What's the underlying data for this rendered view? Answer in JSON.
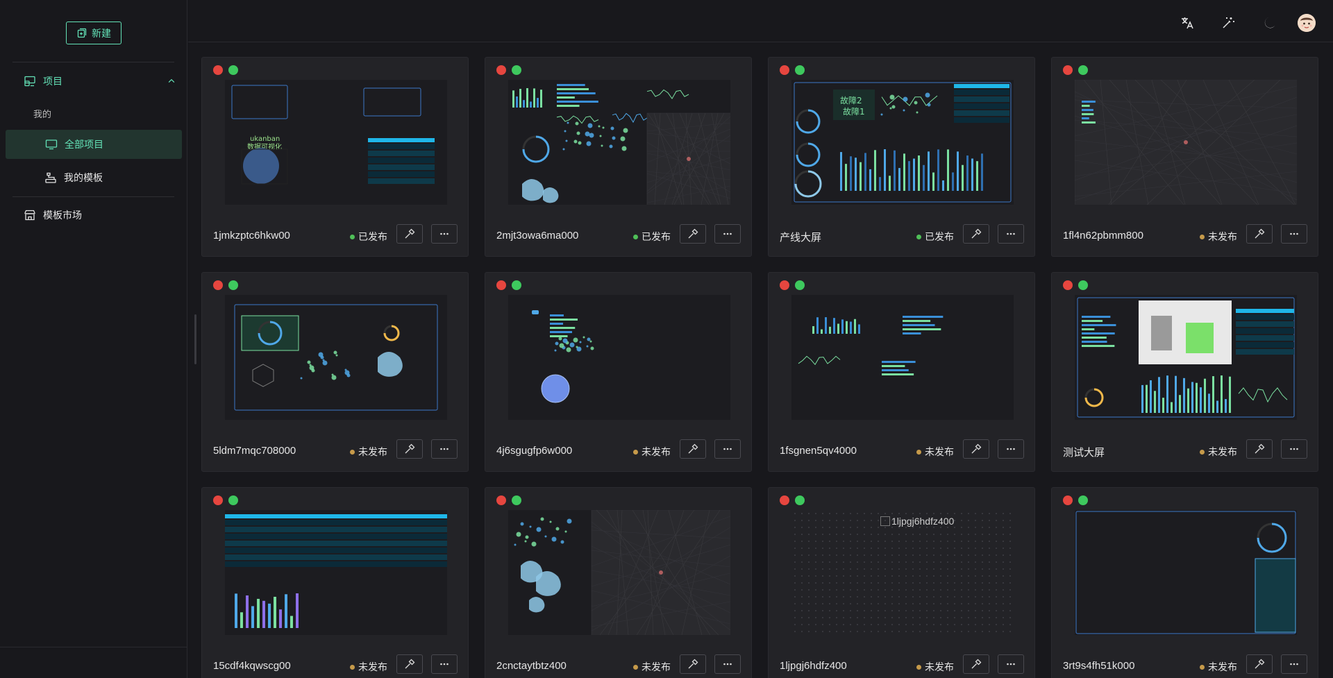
{
  "sidebar": {
    "new_label": "新建",
    "group_title": "项目",
    "section_mine": "我的",
    "item_all_projects": "全部项目",
    "item_my_templates": "我的模板",
    "item_template_market": "模板市场"
  },
  "header": {
    "icons": [
      "translate-icon",
      "magic-wand-icon",
      "moon-icon",
      "avatar"
    ]
  },
  "colors": {
    "accent": "#63e2b7",
    "published": "#4fbf58",
    "unpublished": "#c69a4a",
    "dot_red": "#e6463f",
    "dot_green": "#3ec95e"
  },
  "projects": [
    {
      "name": "1jmkzptc6hkw00",
      "status": "已发布"
    },
    {
      "name": "2mjt3owa6ma000",
      "status": "已发布"
    },
    {
      "name": "产线大屏",
      "status": "已发布"
    },
    {
      "name": "1fl4n62pbmm800",
      "status": "未发布"
    },
    {
      "name": "5ldm7mqc708000",
      "status": "未发布"
    },
    {
      "name": "4j6sgugfp6w000",
      "status": "未发布"
    },
    {
      "name": "1fsgnen5qv4000",
      "status": "未发布"
    },
    {
      "name": "测试大屏",
      "status": "未发布"
    },
    {
      "name": "15cdf4kqwscg00",
      "status": "未发布"
    },
    {
      "name": "2cnctaytbtz400",
      "status": "未发布"
    },
    {
      "name": "1ljpgj6hdfz400",
      "status": "未发布",
      "image_alt": "1ljpgj6hdfz400"
    },
    {
      "name": "3rt9s4fh51k000",
      "status": "未发布"
    }
  ]
}
